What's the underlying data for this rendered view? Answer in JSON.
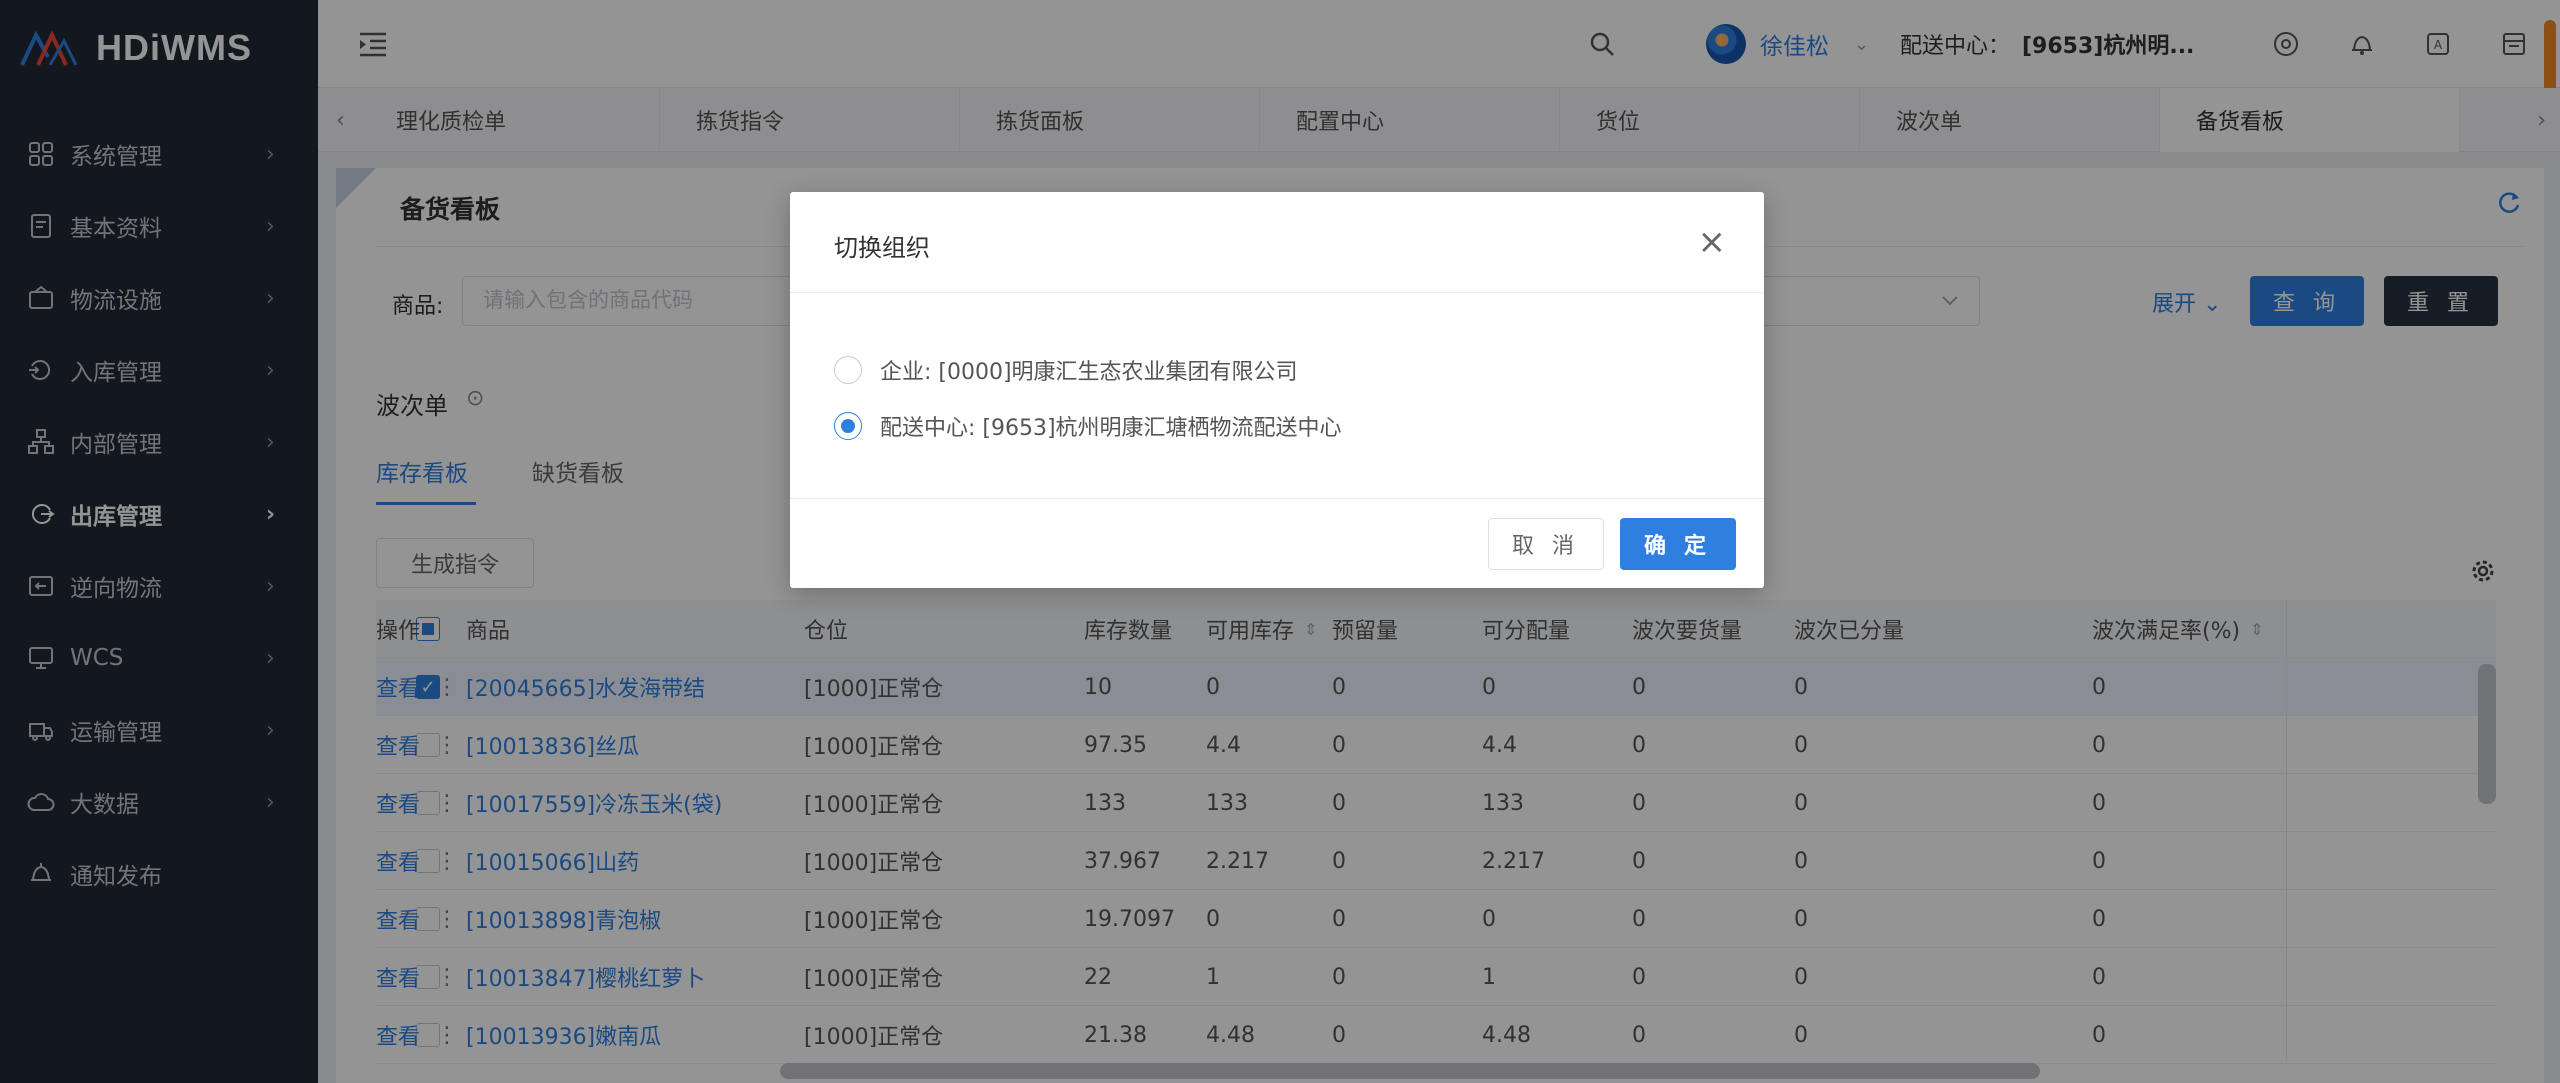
{
  "app": {
    "title": "HDiWMS"
  },
  "sidebar": {
    "items": [
      {
        "label": "系统管理",
        "icon": "grid-icon"
      },
      {
        "label": "基本资料",
        "icon": "document-icon"
      },
      {
        "label": "物流设施",
        "icon": "facility-icon"
      },
      {
        "label": "入库管理",
        "icon": "inbound-icon"
      },
      {
        "label": "内部管理",
        "icon": "org-chart-icon"
      },
      {
        "label": "出库管理",
        "icon": "outbound-icon",
        "active": true
      },
      {
        "label": "逆向物流",
        "icon": "return-icon"
      },
      {
        "label": "WCS",
        "icon": "monitor-icon"
      },
      {
        "label": "运输管理",
        "icon": "truck-icon"
      },
      {
        "label": "大数据",
        "icon": "cloud-icon"
      },
      {
        "label": "通知发布",
        "icon": "bell-icon"
      }
    ],
    "arrow": "›"
  },
  "header": {
    "user_name": "徐佳松",
    "user_caret": "⌄",
    "center_label": "配送中心：",
    "center_value": "[9653]杭州明..."
  },
  "tabs": {
    "prev": "‹",
    "next": "›",
    "items": [
      "理化质检单",
      "拣货指令",
      "拣货面板",
      "配置中心",
      "货位",
      "波次单",
      "备货看板"
    ],
    "active_index": 6
  },
  "page": {
    "title": "备货看板",
    "goods_label": "商品:",
    "goods_placeholder": "请输入包含的商品代码",
    "expand_label": "展开 ⌄",
    "query_label": "查 询",
    "reset_label": "重 置",
    "wave_label": "波次单",
    "wave_toggle": "⊙",
    "sub_tab_stock": "库存看板",
    "sub_tab_short": "缺货看板",
    "generate_label": "生成指令"
  },
  "table": {
    "columns": [
      "商品",
      "仓位",
      "库存数量",
      "可用库存",
      "预留量",
      "可分配量",
      "波次要货量",
      "波次已分量",
      "波次满足率(%)",
      "操作"
    ],
    "sort_glyph": "⇕",
    "view_label": "查看",
    "more_label": "⋮",
    "rows": [
      {
        "goods": "[20045665]水发海带结",
        "loc": "[1000]正常仓",
        "qty": "10",
        "avail": "0",
        "reserve": "0",
        "alloc": "0",
        "wave_req": "0",
        "wave_done": "0",
        "rate": "0",
        "checked": true
      },
      {
        "goods": "[10013836]丝瓜",
        "loc": "[1000]正常仓",
        "qty": "97.35",
        "avail": "4.4",
        "reserve": "0",
        "alloc": "4.4",
        "wave_req": "0",
        "wave_done": "0",
        "rate": "0",
        "checked": false
      },
      {
        "goods": "[10017559]冷冻玉米(袋)",
        "loc": "[1000]正常仓",
        "qty": "133",
        "avail": "133",
        "reserve": "0",
        "alloc": "133",
        "wave_req": "0",
        "wave_done": "0",
        "rate": "0",
        "checked": false
      },
      {
        "goods": "[10015066]山药",
        "loc": "[1000]正常仓",
        "qty": "37.967",
        "avail": "2.217",
        "reserve": "0",
        "alloc": "2.217",
        "wave_req": "0",
        "wave_done": "0",
        "rate": "0",
        "checked": false
      },
      {
        "goods": "[10013898]青泡椒",
        "loc": "[1000]正常仓",
        "qty": "19.7097",
        "avail": "0",
        "reserve": "0",
        "alloc": "0",
        "wave_req": "0",
        "wave_done": "0",
        "rate": "0",
        "checked": false
      },
      {
        "goods": "[10013847]樱桃红萝卜",
        "loc": "[1000]正常仓",
        "qty": "22",
        "avail": "1",
        "reserve": "0",
        "alloc": "1",
        "wave_req": "0",
        "wave_done": "0",
        "rate": "0",
        "checked": false
      },
      {
        "goods": "[10013936]嫩南瓜",
        "loc": "[1000]正常仓",
        "qty": "21.38",
        "avail": "4.48",
        "reserve": "0",
        "alloc": "4.48",
        "wave_req": "0",
        "wave_done": "0",
        "rate": "0",
        "checked": false
      }
    ]
  },
  "modal": {
    "title": "切换组织",
    "close": "×",
    "options": [
      {
        "label": "企业: [0000]明康汇生态农业集团有限公司",
        "selected": false
      },
      {
        "label": "配送中心: [9653]杭州明康汇塘栖物流配送中心",
        "selected": true
      }
    ],
    "cancel_label": "取 消",
    "ok_label": "确 定"
  },
  "colors": {
    "accent": "#2f7fe0",
    "sidebar_bg": "#212834",
    "dark_button": "#283342",
    "scroll_accent": "#f08a24"
  }
}
